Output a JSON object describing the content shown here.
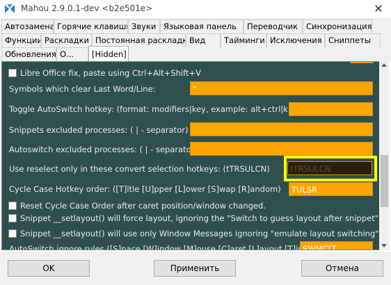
{
  "window": {
    "title": "Mahou 2.9.0.1-dev <b2e501e>",
    "close_glyph": "✕"
  },
  "tabs": {
    "row1": [
      "Автозамена",
      "Горячие клавиши",
      "Звуки",
      "Языковая панель",
      "Переводчик",
      "Синхронизация"
    ],
    "row2": [
      "Функции",
      "Раскладки",
      "Постоянная раскладка",
      "Вид",
      "Тайминги",
      "Исключения",
      "Сниппеты"
    ],
    "row3": [
      "Обновления",
      "О...",
      "[Hidden]"
    ],
    "active": "[Hidden]"
  },
  "settings": {
    "libre_office_fix": {
      "label": "Libre Office fix, paste using Ctrl+Alt+Shift+V",
      "checked": false
    },
    "symbols_clear": {
      "label": "Symbols which clear Last Word/Line:",
      "value": "\""
    },
    "toggle_autoswitch": {
      "label": "Toggle AutoSwitch hotkey: (format: modifiers|key, example: alt+ctrl|k)",
      "value": ""
    },
    "snippets_excluded": {
      "label": "Snippets excluded processes: ( | - separator)",
      "value": ""
    },
    "autoswitch_excluded": {
      "label": "Autoswitch excluded processes: ( | - separator)",
      "value": ""
    },
    "reselect_hotkeys": {
      "label": "Use reselect only in these convert selection hotkeys: (tTRSULCN)",
      "value": "tTRSULCN"
    },
    "cycle_case_order": {
      "label": "Cycle Case Hotkey order: ([T]itle [U]pper [L]ower [S]wap [R]andom)",
      "value": "TULSR"
    },
    "reset_cycle_case": {
      "label": "Reset Cycle Case Order after caret position/window changed.",
      "checked": false
    },
    "setlayout_force": {
      "label": "Snippet __setlayout() will force layout, ignoring the \"Switch to guess layout after snippet\".",
      "checked": false
    },
    "setlayout_messages": {
      "label": "Snippet __setlayout() will use only Window Messages ignoring \"emulate layout switching\".",
      "checked": false
    },
    "autoswitch_ignore": {
      "label": "AutoSwitch ignore rules ([S]pace [W]indow [M]ouse [C]aret [L]ayout [T]imer):",
      "value": "SWMCLT"
    }
  },
  "buttons": {
    "ok": "OK",
    "apply": "Применить",
    "cancel": "Отмена"
  },
  "colors": {
    "panel_bg": "#2f4f4f",
    "field_bg": "#ffa500",
    "highlight": "#ffff00"
  }
}
